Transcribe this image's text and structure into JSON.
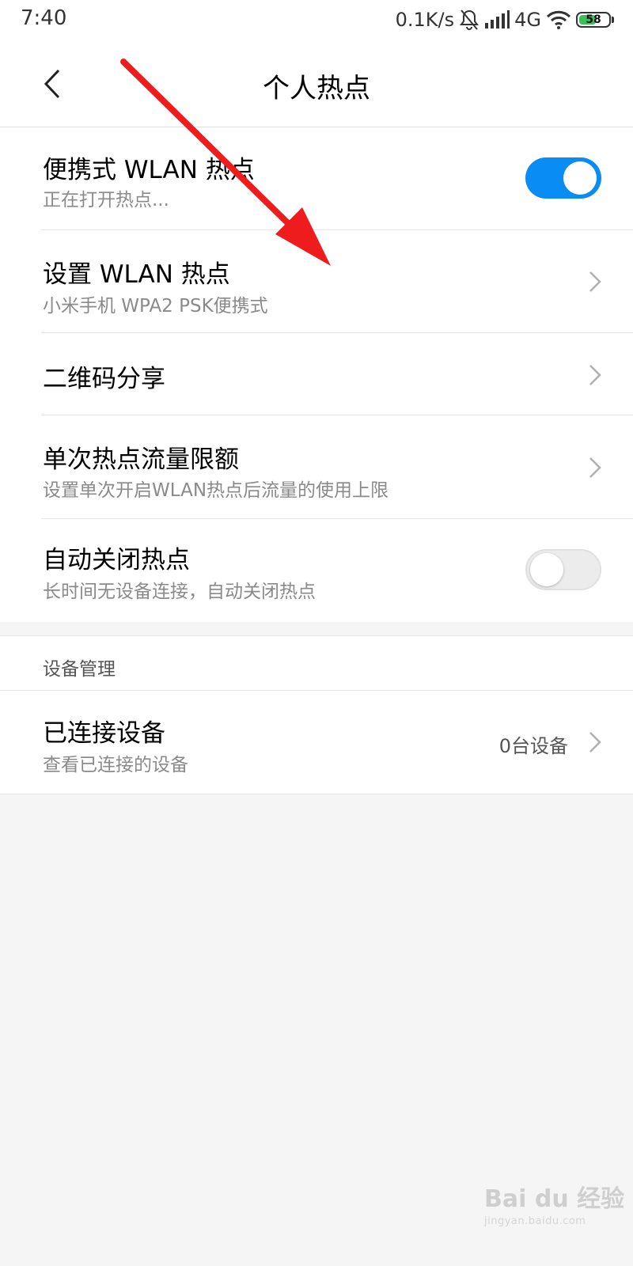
{
  "status_bar": {
    "time": "7:40",
    "net_speed": "0.1K/s",
    "network_type": "4G",
    "battery_level": "58",
    "battery_fraction": 0.58,
    "icons": [
      "bell-off-icon",
      "signal-icon",
      "wifi-icon",
      "battery-icon"
    ]
  },
  "header": {
    "title": "个人热点",
    "back_icon": "chevron-left-icon"
  },
  "settings": {
    "portable_hotspot": {
      "title": "便携式 WLAN 热点",
      "subtitle": "正在打开热点...",
      "enabled": true
    },
    "setup_hotspot": {
      "title": "设置 WLAN 热点",
      "subtitle": "小米手机 WPA2 PSK便携式"
    },
    "qr_share": {
      "title": "二维码分享"
    },
    "data_limit": {
      "title": "单次热点流量限额",
      "subtitle": "设置单次开启WLAN热点后流量的使用上限"
    },
    "auto_close": {
      "title": "自动关闭热点",
      "subtitle": "长时间无设备连接，自动关闭热点",
      "enabled": false
    }
  },
  "device_management": {
    "section_label": "设备管理",
    "connected_devices": {
      "title": "已连接设备",
      "subtitle": "查看已连接的设备",
      "value": "0台设备"
    }
  },
  "annotation": {
    "arrow_color": "#ee1c1c"
  },
  "watermark": {
    "brand": "Bai du 经验",
    "url": "jingyan.baidu.com"
  },
  "colors": {
    "toggle_on": "#0a8cf5",
    "toggle_off": "#ececec",
    "background": "#f5f5f5"
  }
}
